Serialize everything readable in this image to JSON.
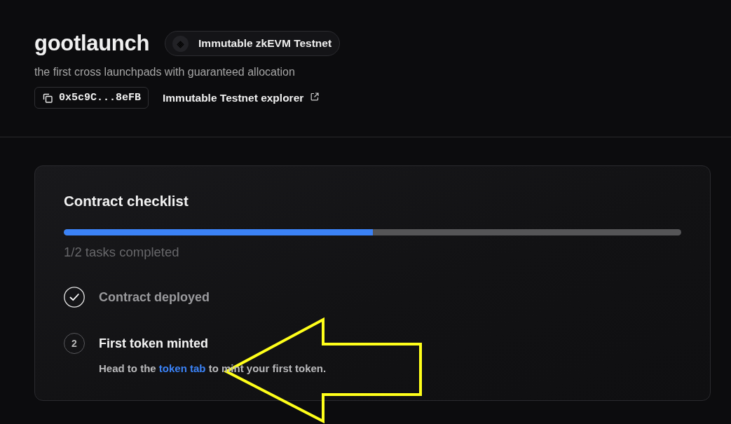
{
  "header": {
    "title": "gootlaunch",
    "network": "Immutable zkEVM Testnet",
    "tagline": "the first cross launchpads with guaranteed allocation",
    "address": "0x5c9C...8eFB",
    "explorer_link": "Immutable Testnet explorer"
  },
  "checklist": {
    "title": "Contract checklist",
    "progress": {
      "level": 0.5
    },
    "status": "1/2 tasks completed",
    "tasks": [
      {
        "title": "Contract deployed",
        "done": true
      },
      {
        "title": "First token minted",
        "done": false,
        "number": "2",
        "description": {
          "before": "Head to the",
          "link": "token tab",
          "after": "to mint your first token."
        }
      }
    ]
  }
}
